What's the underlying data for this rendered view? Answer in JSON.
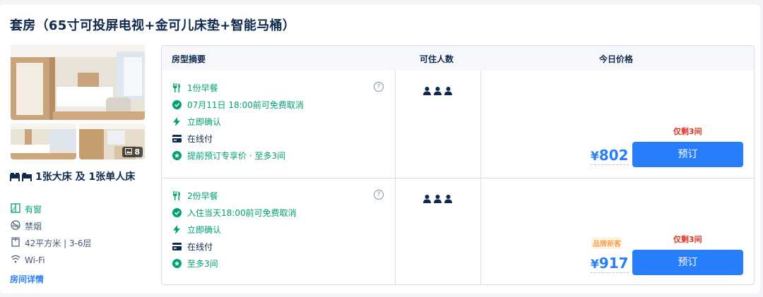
{
  "room": {
    "title": "套房（65寸可投屏电视+金可儿床垫+智能马桶）",
    "photo_count": "8",
    "bed": "1张大床 及 1张单人床",
    "features": {
      "window": "有窗",
      "smoking": "禁烟",
      "area": "42平方米 | 3-6层",
      "wifi": "Wi-Fi"
    },
    "details_link": "房间详情"
  },
  "table": {
    "headers": {
      "summary": "房型摘要",
      "capacity": "可住人数",
      "price": "今日价格"
    },
    "rows": [
      {
        "breakfast": "1份早餐",
        "cancel": "07月11日 18:00前可免费取消",
        "confirm": "立即确认",
        "payment": "在线付",
        "promo": "提前预订专享价 · 至多3间",
        "remaining": "仅剩3间",
        "currency": "¥",
        "price": "802",
        "book_label": "预订"
      },
      {
        "breakfast": "2份早餐",
        "cancel": "入住当天18:00前可免费取消",
        "confirm": "立即确认",
        "payment": "在线付",
        "promo": "至多3间",
        "brand_tag": "品牌新客",
        "remaining": "仅剩3间",
        "currency": "¥",
        "price": "917",
        "book_label": "预订"
      }
    ]
  },
  "colors": {
    "accent": "#287dfa",
    "green": "#00a175",
    "warning": "#e0301e",
    "brand": "#ff7700"
  }
}
